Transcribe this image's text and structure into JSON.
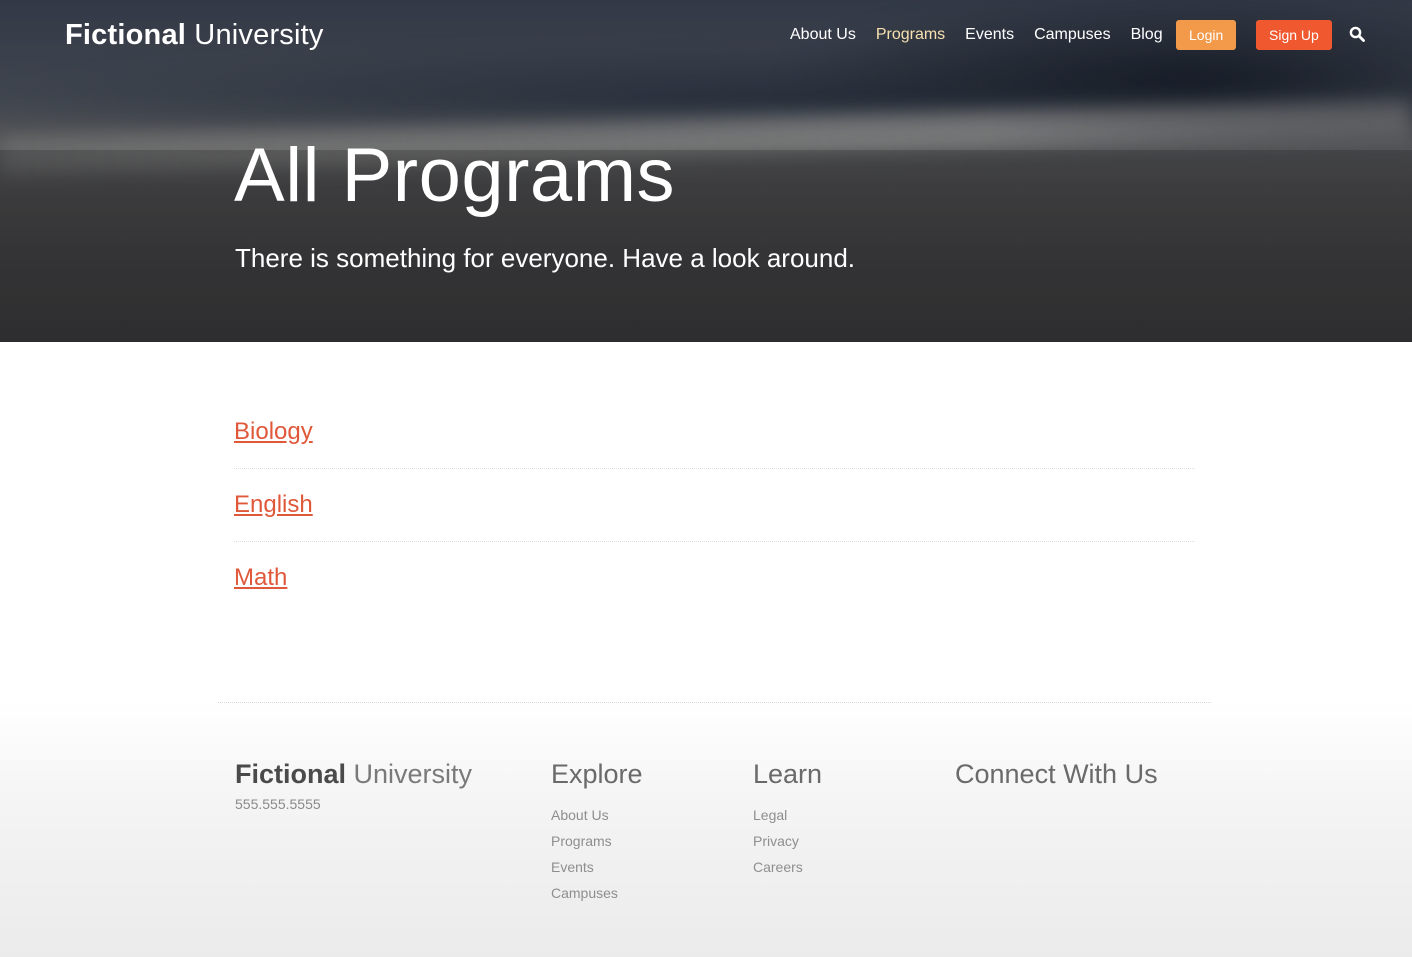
{
  "header": {
    "logo_bold": "Fictional",
    "logo_light": "University",
    "nav": [
      {
        "label": "About Us"
      },
      {
        "label": "Programs"
      },
      {
        "label": "Events"
      },
      {
        "label": "Campuses"
      },
      {
        "label": "Blog"
      }
    ],
    "active_nav": "Programs",
    "login_label": "Login",
    "signup_label": "Sign Up",
    "search_icon": "search-icon"
  },
  "hero": {
    "title": "All Programs",
    "subtitle": "There is something for everyone. Have a look around."
  },
  "programs": [
    {
      "label": "Biology"
    },
    {
      "label": "English"
    },
    {
      "label": "Math"
    }
  ],
  "footer": {
    "logo_bold": "Fictional",
    "logo_light": "University",
    "phone": "555.555.5555",
    "explore": {
      "title": "Explore",
      "items": [
        "About Us",
        "Programs",
        "Events",
        "Campuses"
      ]
    },
    "learn": {
      "title": "Learn",
      "items": [
        "Legal",
        "Privacy",
        "Careers"
      ]
    },
    "connect": {
      "title": "Connect With Us"
    }
  },
  "colors": {
    "link": "#e0583a",
    "login_button": "#f2994a",
    "signup_button": "#f0582f",
    "active_nav": "#f7e1b0"
  }
}
